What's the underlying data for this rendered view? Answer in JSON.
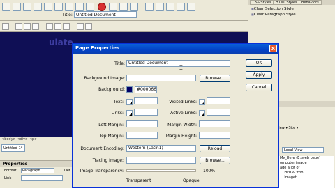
{
  "toolbar": {
    "title_label": "Title:",
    "title_value": "Untitled Document"
  },
  "document": {
    "text": "ulate"
  },
  "status": {
    "tag_selector": "<body> <div> <p>",
    "doc_tab": "Untitled-1*"
  },
  "properties_panel": {
    "title": "Properties",
    "format_label": "Format",
    "format_value": "Paragraph",
    "link_label": "Link",
    "default_label": "Def"
  },
  "right_panel": {
    "tabs": [
      "CSS Styles",
      "HTML Styles",
      "Behaviors"
    ],
    "styles": [
      "Clear Selection Style",
      "Clear Paragraph Style"
    ],
    "section_label": "s",
    "files_menu": "View ▾  Site ▾",
    "view_select": "Local View",
    "tree_items": [
      "My_Here (E:\\web page)",
      "omputer image",
      "age a lot of",
      "... HFB & fthb",
      "... Imageti"
    ]
  },
  "dialog": {
    "title": "Page Properties",
    "close_label": "x",
    "fields": {
      "title_label": "Title:",
      "title_value": "Untitled Document",
      "background_image_label": "Background Image:",
      "background_image_value": "",
      "background_label": "Background:",
      "background_value": "#000066",
      "background_color": "#000066",
      "text_label": "Text:",
      "visited_links_label": "Visited Links:",
      "links_label": "Links:",
      "active_links_label": "Active Links:",
      "left_margin_label": "Left Margin:",
      "margin_width_label": "Margin Width:",
      "top_margin_label": "Top Margin:",
      "margin_height_label": "Margin Height:",
      "document_encoding_label": "Document Encoding:",
      "document_encoding_value": "Western (Latin1)",
      "tracing_image_label": "Tracing Image:",
      "image_transparency_label": "Image Transparency:",
      "transparency_value": "100%",
      "transparency_level": 1.0,
      "transparent_label": "Transparent",
      "opaque_label": "Opaque"
    },
    "buttons": {
      "ok": "OK",
      "apply": "Apply",
      "cancel": "Cancel",
      "browse1": "Browse...",
      "reload": "Reload",
      "browse2": "Browse..."
    }
  }
}
